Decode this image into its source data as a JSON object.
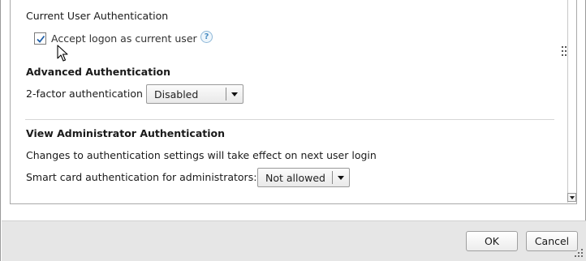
{
  "current_user_auth": {
    "section_label": "Current User Authentication",
    "accept_logon_label": "Accept logon as current user",
    "accept_logon_checked": true,
    "help_glyph": "?"
  },
  "advanced_auth": {
    "heading": "Advanced Authentication",
    "two_factor_label": "2-factor authentication",
    "two_factor_value": "Disabled"
  },
  "admin_auth": {
    "heading": "View Administrator Authentication",
    "note": "Changes to authentication settings will take effect on next user login",
    "smart_card_label": "Smart card authentication for administrators:",
    "smart_card_value": "Not allowed"
  },
  "footer": {
    "ok_label": "OK",
    "cancel_label": "Cancel"
  },
  "colors": {
    "check_accent": "#1f5fa8",
    "help_accent": "#4a8dc2",
    "footer_bg": "#e6e6e6"
  }
}
